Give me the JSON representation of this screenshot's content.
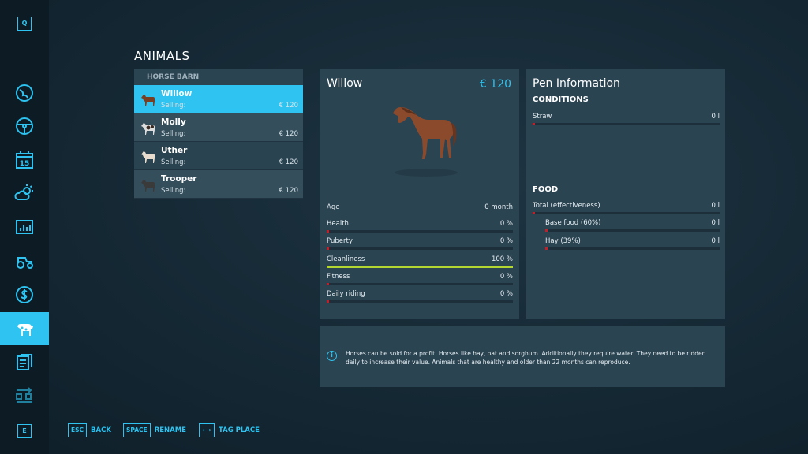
{
  "sidebar": {
    "top_key": "Q",
    "bottom_key": "E",
    "icons": [
      "map-icon",
      "steering-wheel-icon",
      "calendar-icon",
      "weather-icon",
      "statistics-icon",
      "vehicles-icon",
      "finance-icon",
      "animals-icon",
      "contracts-icon",
      "production-icon"
    ],
    "calendar_day": "15",
    "active": "animals-icon"
  },
  "page_title": "ANIMALS",
  "barn": {
    "header": "HORSE BARN",
    "items": [
      {
        "name": "Willow",
        "selling_label": "Selling:",
        "price": "€ 120"
      },
      {
        "name": "Molly",
        "selling_label": "Selling:",
        "price": "€ 120"
      },
      {
        "name": "Uther",
        "selling_label": "Selling:",
        "price": "€ 120"
      },
      {
        "name": "Trooper",
        "selling_label": "Selling:",
        "price": "€ 120"
      }
    ]
  },
  "detail": {
    "name": "Willow",
    "price": "€ 120",
    "age_label": "Age",
    "age_value": "0 month",
    "stats": [
      {
        "label": "Health",
        "value": "0 %",
        "fraction": 0
      },
      {
        "label": "Puberty",
        "value": "0 %",
        "fraction": 0
      },
      {
        "label": "Cleanliness",
        "value": "100 %",
        "fraction": 1
      },
      {
        "label": "Fitness",
        "value": "0 %",
        "fraction": 0
      },
      {
        "label": "Daily riding",
        "value": "0 %",
        "fraction": 0
      }
    ]
  },
  "pen": {
    "title": "Pen Information",
    "conditions_label": "CONDITIONS",
    "straw_label": "Straw",
    "straw_value": "0 l",
    "food_label": "FOOD",
    "total_label": "Total (effectiveness)",
    "total_value": "0 l",
    "base_label": "Base food (60%)",
    "base_value": "0 l",
    "hay_label": "Hay (39%)",
    "hay_value": "0 l"
  },
  "info_text": "Horses can be sold for a profit. Horses like hay, oat and sorghum. Additionally they require water. They need to be ridden daily to increase their value. Animals that are healthy and older than 22 months can reproduce.",
  "footer": {
    "back_key": "ESC",
    "back_label": "BACK",
    "rename_key": "SPACE",
    "rename_label": "RENAME",
    "tag_label": "TAG PLACE"
  },
  "colors": {
    "accent": "#2ec3f0",
    "bar_bad": "#c61e28",
    "bar_good": "#b4d630"
  }
}
